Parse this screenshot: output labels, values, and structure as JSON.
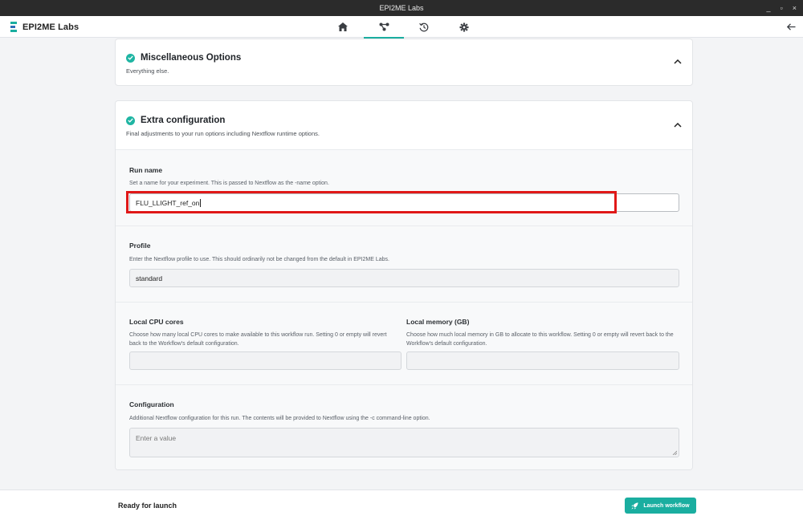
{
  "window": {
    "title": "EPI2ME Labs",
    "controls": [
      "×",
      "▫",
      "_"
    ]
  },
  "appbar": {
    "app_name": "EPI2ME Labs",
    "logo_colors": [
      "#1aaea0",
      "#2c6fb7",
      "#1aaea0"
    ],
    "accent": "#1aaea0",
    "tabs": [
      {
        "icon": "home-icon",
        "active": false
      },
      {
        "icon": "workflow-icon",
        "active": true
      },
      {
        "icon": "history-icon",
        "active": false
      },
      {
        "icon": "gear-icon",
        "active": false
      }
    ]
  },
  "misc_card": {
    "title": "Miscellaneous Options",
    "description": "Everything else."
  },
  "extra_card": {
    "title": "Extra configuration",
    "description": "Final adjustments to your run options including Nextflow runtime options.",
    "run_name": {
      "label": "Run name",
      "help": "Set a name for your experiment. This is passed to Nextflow as the -name option.",
      "value": "FLU_LLIGHT_ref_on"
    },
    "profile": {
      "label": "Profile",
      "help": "Enter the Nextflow profile to use. This should ordinarily not be changed from the default in EPI2ME Labs.",
      "value": "standard"
    },
    "cpu": {
      "label": "Local CPU cores",
      "help": "Choose how many local CPU cores to make available to this workflow run. Setting 0 or empty will revert back to the Workflow's default configuration.",
      "value": ""
    },
    "memory": {
      "label": "Local memory (GB)",
      "help": "Choose how much local memory in GB to allocate to this workflow. Setting 0 or empty will revert back to the Workflow's default configuration.",
      "value": ""
    },
    "config": {
      "label": "Configuration",
      "help": "Additional Nextflow configuration for this run. The contents will be provided to Nextflow using the -c command-line option.",
      "placeholder": "Enter a value"
    }
  },
  "footer": {
    "status": "Ready for launch",
    "launch_label": "Launch workflow"
  }
}
